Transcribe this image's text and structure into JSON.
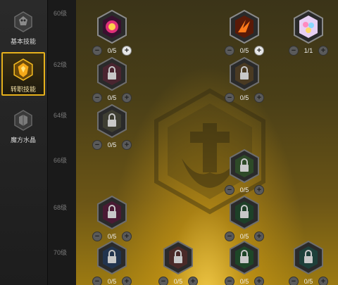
{
  "sidebar": {
    "items": [
      {
        "label": "基本技能",
        "icon": "skull-crest-icon",
        "active": false
      },
      {
        "label": "转职技能",
        "icon": "golden-crest-icon",
        "active": true
      },
      {
        "label": "魔方水晶",
        "icon": "cube-crest-icon",
        "active": false
      }
    ]
  },
  "levels": [
    "60级",
    "62级",
    "64级",
    "66级",
    "68级",
    "70级"
  ],
  "skills": [
    {
      "id": "s1",
      "icon": "pink-burst-skill-icon",
      "count": "0/5",
      "locked": false,
      "accent": "#d04a8a"
    },
    {
      "id": "s2",
      "icon": "fire-claw-skill-icon",
      "count": "0/5",
      "locked": false,
      "accent": "#e0602a"
    },
    {
      "id": "s3",
      "icon": "rainbow-cube-skill-icon",
      "count": "1/1",
      "locked": false,
      "accent": "#c79ee0"
    },
    {
      "id": "s4",
      "icon": "lock-icon",
      "count": "0/5",
      "locked": true,
      "accent": "#8a3a4e"
    },
    {
      "id": "s5",
      "icon": "lock-icon",
      "count": "0/5",
      "locked": true,
      "accent": "#8a6a3a"
    },
    {
      "id": "s6",
      "icon": "lock-icon",
      "count": "0/5",
      "locked": true,
      "accent": "#6e6e5a"
    },
    {
      "id": "s7",
      "icon": "lock-icon",
      "count": "0/5",
      "locked": true,
      "accent": "#3f7a3a"
    },
    {
      "id": "s8",
      "icon": "lock-icon",
      "count": "0/5",
      "locked": true,
      "accent": "#8a2a5a"
    },
    {
      "id": "s9",
      "icon": "lock-icon",
      "count": "0/5",
      "locked": true,
      "accent": "#2e6e3a"
    },
    {
      "id": "s10",
      "icon": "lock-icon",
      "count": "0/5",
      "locked": true,
      "accent": "#3a5a8a"
    },
    {
      "id": "s11",
      "icon": "lock-icon",
      "count": "0/5",
      "locked": true,
      "accent": "#8a5a4a"
    },
    {
      "id": "s12",
      "icon": "lock-icon",
      "count": "0/5",
      "locked": true,
      "accent": "#2e7a3a"
    },
    {
      "id": "s13",
      "icon": "lock-icon",
      "count": "0/5",
      "locked": true,
      "accent": "#2e6e5a"
    }
  ],
  "colors": {
    "active_border": "#e6b11c",
    "panel_glow": "#ffd650"
  }
}
